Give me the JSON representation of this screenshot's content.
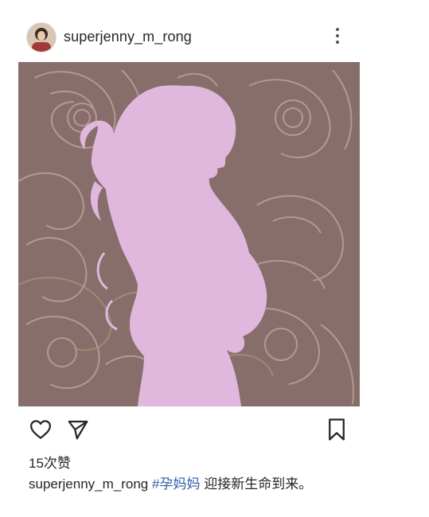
{
  "post": {
    "username": "superjenny_m_rong",
    "likes": "15次赞",
    "caption": {
      "user": "superjenny_m_rong",
      "hashtag": "#孕妈妈",
      "text": " 迎接新生命到来。"
    }
  },
  "icons": {
    "avatar": "avatar",
    "more": "more-vertical-icon",
    "like": "heart-icon",
    "share": "send-icon",
    "save": "bookmark-icon"
  },
  "colors": {
    "photo_background": "#876e6a",
    "silhouette": "#e0b7dd",
    "ornament": "#c9a4a4",
    "hashtag": "#2f5ea8"
  }
}
